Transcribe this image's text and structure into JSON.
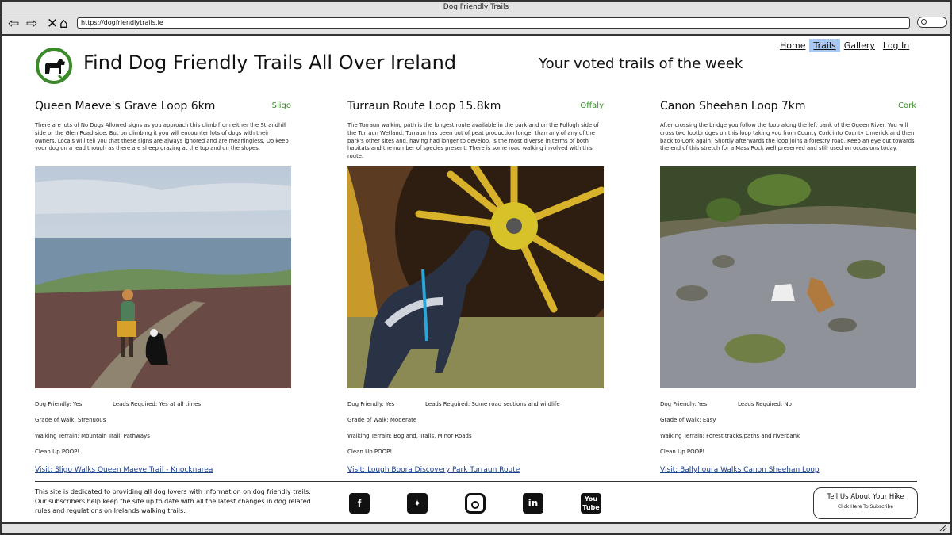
{
  "window": {
    "title": "Dog Friendly Trails"
  },
  "browser": {
    "url": "https://dogfriendlytrails.ie"
  },
  "header": {
    "site_title": "Find Dog Friendly Trails All Over Ireland",
    "subtitle": "Your voted trails of the week"
  },
  "nav": {
    "items": [
      {
        "label": "Home",
        "active": false
      },
      {
        "label": "Trails",
        "active": true
      },
      {
        "label": "Gallery",
        "active": false
      },
      {
        "label": "Log In",
        "active": false
      }
    ]
  },
  "trails": [
    {
      "title": "Queen Maeve's Grave Loop 6km",
      "county": "Sligo",
      "description": "There are lots of No Dogs Allowed signs as you approach this climb from either the Strandhill side or the Glen Road side. But on climbing it you will encounter lots of dogs with their owners. Locals will tell you that these signs are always ignored and are meaningless. Do keep your dog on a lead though as there are sheep grazing at the top and on the slopes.",
      "dog_friendly": "Dog Friendly: Yes",
      "leads": "Leads Required: Yes at all times",
      "grade": "Grade of Walk: Strenuous",
      "terrain": "Walking Terrain: Mountain Trail, Pathways",
      "cleanup": "Clean Up POOP!",
      "visit": "Visit: Sligo Walks Queen Maeve Trail - Knocknarea"
    },
    {
      "title": "Turraun Route Loop 15.8km",
      "county": "Offaly",
      "description": "The Turraun walking path is the longest route available in the park and on the Pollogh side of the Turraun Wetland. Turraun has been out of peat production longer than any of any of the park's other sites and, having had longer to develop, is the most diverse in terms of both habitats and the number of species present. There is some road walking involved with this route.",
      "dog_friendly": "Dog Friendly: Yes",
      "leads": "Leads Required: Some road sections and wildlife",
      "grade": "Grade of Walk: Moderate",
      "terrain": "Walking Terrain: Bogland, Trails, Minor Roads",
      "cleanup": "Clean Up POOP!",
      "visit": "Visit: Lough Boora Discovery Park Turraun Route"
    },
    {
      "title": "Canon Sheehan Loop 7km",
      "county": "Cork",
      "description": "After crossing the bridge you follow the loop along the left bank of the Ogeen River. You will cross two footbridges on this loop taking you from County Cork into County Limerick and then back to Cork again! Shortly afterwards the loop joins a forestry road. Keep an eye out towards the end of this stretch for a Mass Rock well preserved and still used on occasions today.",
      "dog_friendly": "Dog Friendly: Yes",
      "leads": "Leads Required: No",
      "grade": "Grade of Walk: Easy",
      "terrain": "Walking Terrain: Forest tracks/paths and riverbank",
      "cleanup": "Clean Up POOP!",
      "visit": "Visit: Ballyhoura Walks Canon Sheehan Loop"
    }
  ],
  "footer": {
    "about": "This site is dedicated to providing all dog lovers with information on dog friendly trails.  Our subscribers help keep the site up to date with all the latest changes in dog related rules and regulations on Irelands walking trails.",
    "social": [
      "facebook-icon",
      "twitter-icon",
      "instagram-icon",
      "linkedin-icon",
      "youtube-icon"
    ],
    "cta_title": "Tell Us About Your Hike",
    "cta_sub": "Click Here To Subscribe"
  },
  "colors": {
    "accent_green": "#3a8a2a",
    "link_blue": "#1d3f8c",
    "active_nav": "#a9c8f0"
  }
}
